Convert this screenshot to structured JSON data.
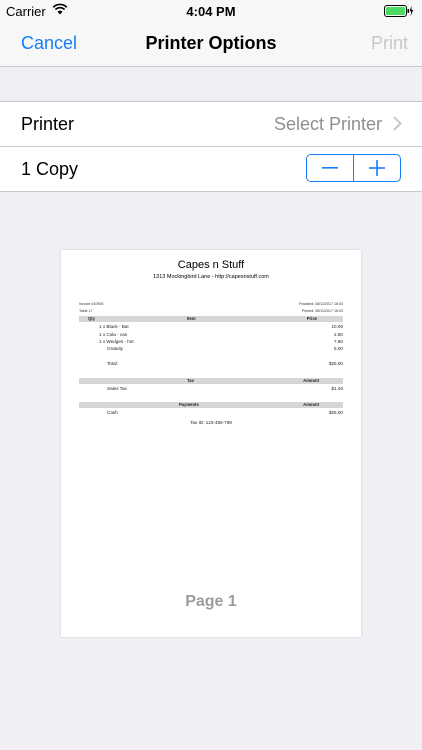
{
  "status": {
    "carrier": "Carrier",
    "time": "4:04 PM"
  },
  "nav": {
    "cancel": "Cancel",
    "title": "Printer Options",
    "print": "Print"
  },
  "printer_row": {
    "label": "Printer",
    "value": "Select Printer"
  },
  "copies_row": {
    "label": "1 Copy"
  },
  "receipt": {
    "business": "Capes n Stuff",
    "address": "1313 Mockingbird Lane - http://capesnstuff.com",
    "invoice": "Invoice #10905",
    "finalized": "Finalized: 08/11/2017 16:03",
    "table": "Table 17",
    "printed": "Printed: 08/11/2017 16:03",
    "headers": {
      "qty": "Qty",
      "item": "Item",
      "price": "Price"
    },
    "items": [
      {
        "desc": "1 x Black - Bat",
        "price": "10.00"
      },
      {
        "desc": "1 x Cola - can",
        "price": "2.60"
      },
      {
        "desc": "1 x Wedges - hot",
        "price": "7.80"
      },
      {
        "desc": "Gratuity",
        "price": "5.00"
      }
    ],
    "total_label": "Total:",
    "total_value": "$25.00",
    "tax_headers": {
      "tax": "Tax",
      "amount": "Amount"
    },
    "tax_label": "Sales Tax",
    "tax_value": "$1.40",
    "pay_headers": {
      "payments": "Payments",
      "amount": "Amount"
    },
    "pay_label": "Cash",
    "pay_value": "$25.00",
    "tax_id": "Tax ID: 123-456-789"
  },
  "preview": {
    "page_label": "Page 1"
  },
  "colors": {
    "accent": "#147efb",
    "battery": "#4cd964",
    "disabled": "#c7c7cc"
  }
}
